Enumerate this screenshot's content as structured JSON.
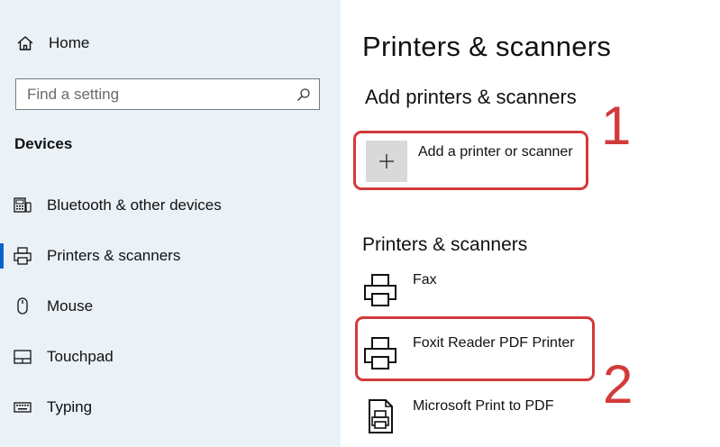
{
  "sidebar": {
    "home_label": "Home",
    "search_placeholder": "Find a setting",
    "section_title": "Devices",
    "items": [
      {
        "label": "Bluetooth & other devices"
      },
      {
        "label": "Printers & scanners"
      },
      {
        "label": "Mouse"
      },
      {
        "label": "Touchpad"
      },
      {
        "label": "Typing"
      }
    ]
  },
  "main": {
    "page_title": "Printers & scanners",
    "add_section_title": "Add printers & scanners",
    "add_button_label": "Add a printer or scanner",
    "list_section_title": "Printers & scanners",
    "printers": [
      {
        "label": "Fax"
      },
      {
        "label": "Foxit Reader PDF Printer"
      },
      {
        "label": "Microsoft Print to PDF"
      }
    ]
  },
  "annotations": {
    "one": "1",
    "two": "2"
  },
  "colors": {
    "accent": "#0a64c8",
    "annotation_red": "#d23a3a",
    "sidebar_bg": "#eaf1f7"
  }
}
